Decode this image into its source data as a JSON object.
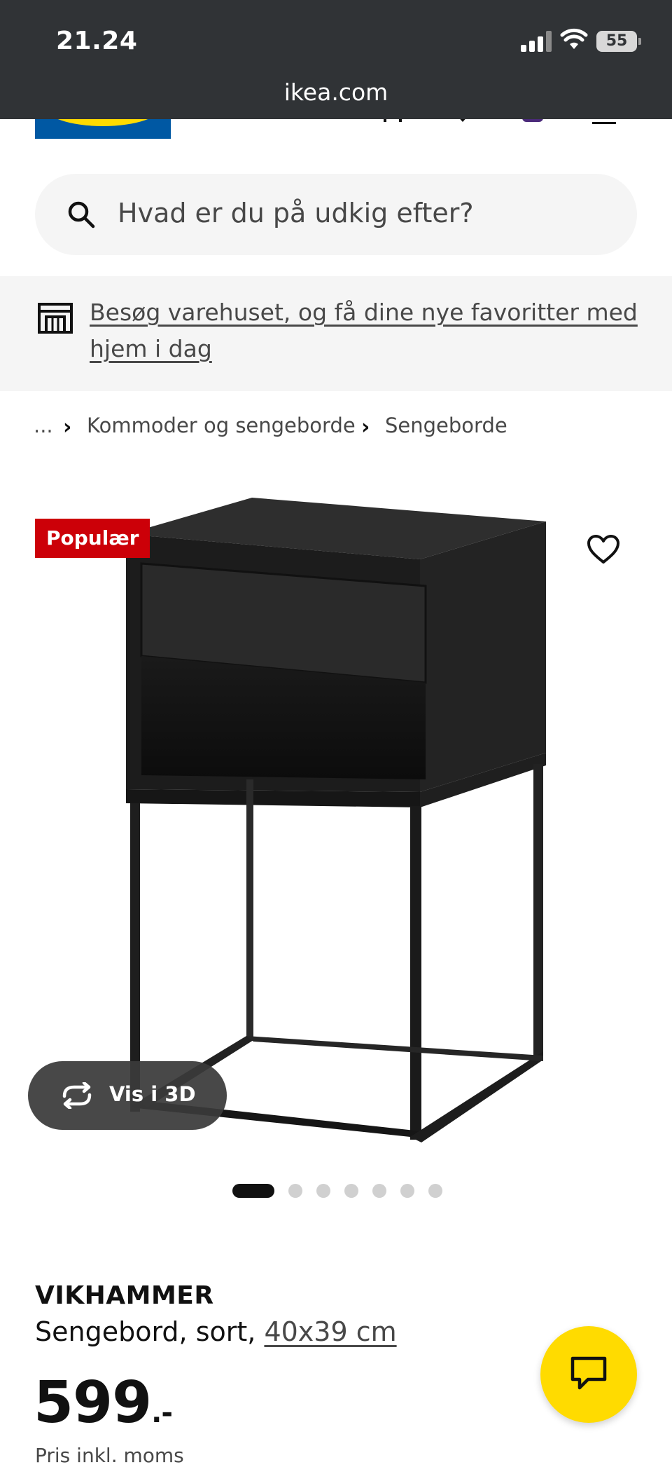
{
  "status_bar": {
    "time": "21.24",
    "battery": "55"
  },
  "browser": {
    "url": "ikea.com"
  },
  "search": {
    "placeholder": "Hvad er du på udkig efter?"
  },
  "store_banner": {
    "text": "Besøg varehuset, og få dine nye favoritter med hjem i dag"
  },
  "breadcrumb": {
    "ellipsis": "...",
    "items": [
      "Kommoder og sengeborde",
      "Sengeborde"
    ]
  },
  "product": {
    "badge": "Populær",
    "view_3d_label": "Vis i 3D",
    "carousel": {
      "total": 7,
      "active": 1
    },
    "name": "VIKHAMMER",
    "description": "Sengebord, sort,",
    "size_link": "40x39 cm",
    "price_main": "599",
    "price_suffix": ".-",
    "price_note": "Pris inkl. moms"
  },
  "colors": {
    "ikea_blue": "#0058a3",
    "ikea_yellow": "#ffdb00",
    "badge_red": "#cc0008",
    "chat_yellow": "#ffdb00"
  }
}
